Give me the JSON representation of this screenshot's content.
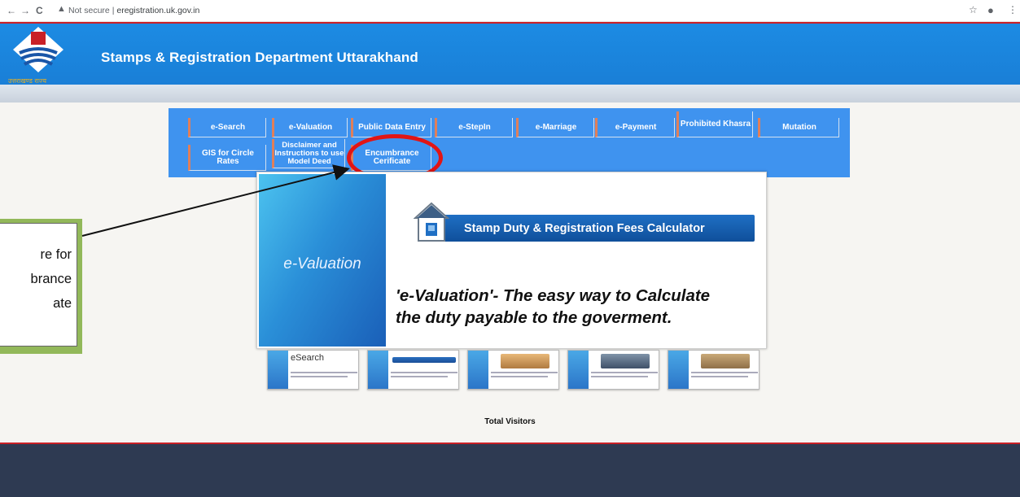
{
  "browser": {
    "nav_back": "←",
    "nav_forward": "→",
    "nav_reload": "C",
    "security_label": "Not secure",
    "separator": "|",
    "url": "eregistration.uk.gov.in",
    "star": "☆",
    "account": "●",
    "menu": "⋮"
  },
  "header": {
    "title": "Stamps & Registration Department Uttarakhand",
    "logo_text": "उत्तराखण्ड राज्य"
  },
  "menu": {
    "row1": [
      "e-Search",
      "e-Valuation",
      "Public Data Entry",
      "e-StepIn",
      "e-Marriage",
      "e-Payment",
      "Prohibited Khasra",
      "Mutation"
    ],
    "row2": [
      "GIS for Circle Rates",
      "Disclaimer and Instructions to use Model Deed",
      "Encumbrance Cerificate"
    ]
  },
  "slide": {
    "left_title": "e-Valuation",
    "banner": "Stamp Duty & Registration Fees Calculator",
    "tagline_line1": "'e-Valuation'- The easy way to Calculate",
    "tagline_line2": "the duty payable to the goverment."
  },
  "thumbnails": [
    {
      "title": "eSearch"
    },
    {
      "title": ""
    },
    {
      "title": ""
    },
    {
      "title": ""
    },
    {
      "title": ""
    }
  ],
  "footer": {
    "visitors_label": "Total Visitors"
  },
  "callout": {
    "line1": "re for",
    "line2": "brance",
    "line3": "ate"
  },
  "colors": {
    "header_blue": "#1c8be3",
    "menu_blue": "#3f93ef",
    "highlight_red": "#e11515",
    "footer_navy": "#2e3a52",
    "callout_green": "#92b85a"
  }
}
